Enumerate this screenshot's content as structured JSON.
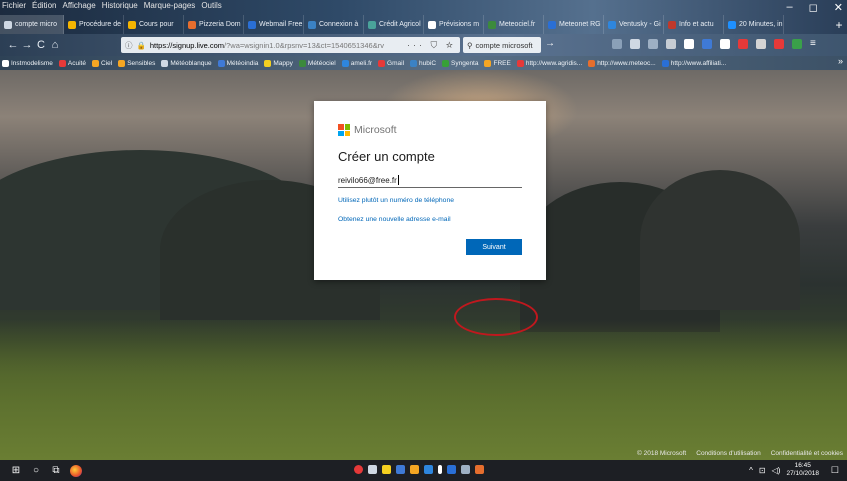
{
  "menubar": {
    "items": [
      "Fichier",
      "Édition",
      "Affichage",
      "Historique",
      "Marque-pages",
      "Outils"
    ]
  },
  "tabs": [
    {
      "label": "compte micro",
      "color": "#cfd8e3",
      "active": true
    },
    {
      "label": "Procédure de",
      "color": "#f4b400",
      "active": false
    },
    {
      "label": "Cours pour",
      "color": "#f4b400",
      "active": false
    },
    {
      "label": "Pizzeria Dom",
      "color": "#e66e2e",
      "active": false
    },
    {
      "label": "Webmail Free",
      "color": "#2a6fd6",
      "active": false
    },
    {
      "label": "Connexion à",
      "color": "#3b82c4",
      "active": false
    },
    {
      "label": "Crédit Agricol",
      "color": "#4aa39a",
      "active": false
    },
    {
      "label": "Prévisions m",
      "color": "#ffffff",
      "active": false
    },
    {
      "label": "Meteociel.fr",
      "color": "#3c8a3c",
      "active": false
    },
    {
      "label": "Meteonet RG",
      "color": "#2a6fd6",
      "active": false
    },
    {
      "label": "Ventusky - Gi",
      "color": "#2e86de",
      "active": false
    },
    {
      "label": "Info et actu",
      "color": "#c0392b",
      "active": false
    },
    {
      "label": "20 Minutes, in",
      "color": "#1e90ff",
      "active": false
    }
  ],
  "window_controls": [
    "–",
    "◻",
    "✕"
  ],
  "toolbar": {
    "back": "←",
    "forward": "→",
    "reload": "C",
    "home": "⌂",
    "url_domain": "https://signup.live.com",
    "url_path": "/?wa=wsignin1.0&rpsnv=13&ct=1540651346&rv",
    "url_actions": "··· ⛉ ☆",
    "search_text": "compte microsoft",
    "search_go": "→"
  },
  "bookmarks": [
    {
      "label": "Instmodelisme",
      "color": "#ffffff"
    },
    {
      "label": "Acuité",
      "color": "#e63939"
    },
    {
      "label": "Ciel",
      "color": "#f5a623"
    },
    {
      "label": "Sensibles",
      "color": "#f5a623"
    },
    {
      "label": "Météoblanque",
      "color": "#cfd8e3"
    },
    {
      "label": "Météoindia",
      "color": "#3f7ad6"
    },
    {
      "label": "Mappy",
      "color": "#f5d020"
    },
    {
      "label": "Météociel",
      "color": "#3c8a3c"
    },
    {
      "label": "ameli.fr",
      "color": "#2e86de"
    },
    {
      "label": "Gmail",
      "color": "#e63939"
    },
    {
      "label": "hubiC",
      "color": "#3b82c4"
    },
    {
      "label": "Syngenta",
      "color": "#37a137"
    },
    {
      "label": "FREE",
      "color": "#f5a623"
    },
    {
      "label": "http://www.agridis...",
      "color": "#e63939"
    },
    {
      "label": "http://www.meteoc...",
      "color": "#e66e2e"
    },
    {
      "label": "http://www.affiliati...",
      "color": "#2a6fd6"
    }
  ],
  "bookmarks_more": "»",
  "dialog": {
    "brand": "Microsoft",
    "title": "Créer un compte",
    "email_value": "reivilo66@free.fr",
    "link_phone": "Utilisez plutôt un numéro de téléphone",
    "link_new_email": "Obtenez une nouvelle adresse e-mail",
    "next_button": "Suivant"
  },
  "page_footer": {
    "copyright": "© 2018 Microsoft",
    "terms": "Conditions d'utilisation",
    "privacy": "Confidentialité et cookies"
  },
  "taskbar": {
    "time": "16:45",
    "date": "27/10/2018"
  },
  "colors": {
    "accent_button": "#0067b8",
    "link": "#0067b8",
    "annotation": "#c0181e",
    "ms_red": "#f25022",
    "ms_green": "#7fba00",
    "ms_blue": "#00a4ef",
    "ms_yellow": "#ffb900"
  }
}
